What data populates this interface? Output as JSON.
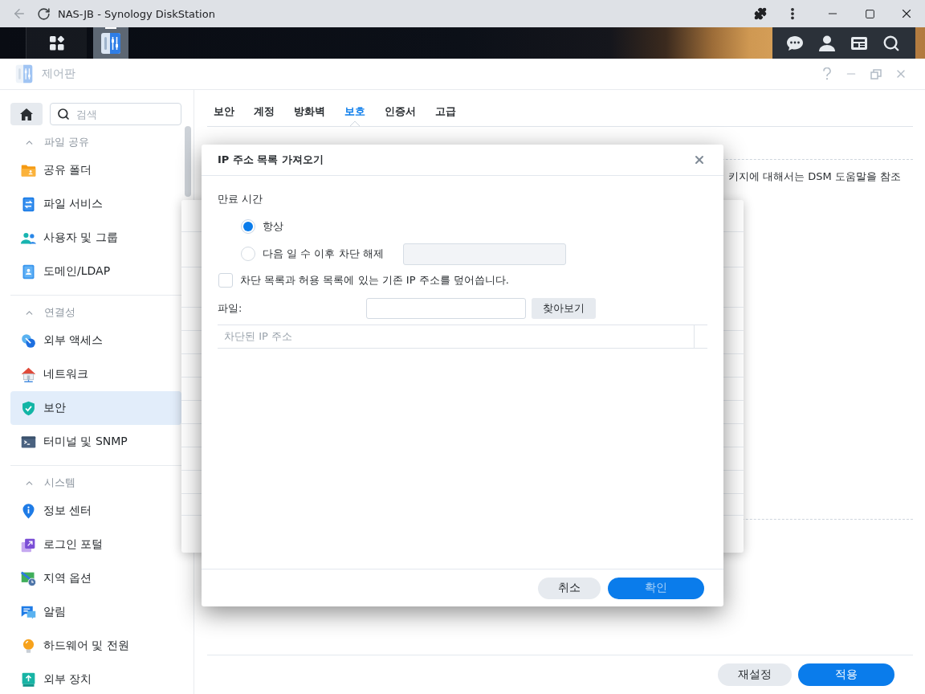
{
  "browser": {
    "title": "NAS-JB - Synology DiskStation"
  },
  "window": {
    "title": "제어판"
  },
  "sidebar": {
    "search": {
      "placeholder": "검색"
    },
    "sections": [
      {
        "title": "파일 공유",
        "expanded": true,
        "items": [
          {
            "label": "공유 폴더",
            "selected": false
          },
          {
            "label": "파일 서비스",
            "selected": false
          },
          {
            "label": "사용자 및 그룹",
            "selected": false
          },
          {
            "label": "도메인/LDAP",
            "selected": false
          }
        ]
      },
      {
        "title": "연결성",
        "expanded": true,
        "items": [
          {
            "label": "외부 액세스",
            "selected": false
          },
          {
            "label": "네트워크",
            "selected": false
          },
          {
            "label": "보안",
            "selected": true
          },
          {
            "label": "터미널 및 SNMP",
            "selected": false
          }
        ]
      },
      {
        "title": "시스템",
        "expanded": true,
        "items": [
          {
            "label": "정보 센터",
            "selected": false
          },
          {
            "label": "로그인 포털",
            "selected": false
          },
          {
            "label": "지역 옵션",
            "selected": false
          },
          {
            "label": "알림",
            "selected": false
          },
          {
            "label": "하드웨어 및 전원",
            "selected": false
          },
          {
            "label": "외부 장치",
            "selected": false
          }
        ]
      }
    ]
  },
  "tabs": [
    {
      "label": "보안",
      "selected": false
    },
    {
      "label": "계정",
      "selected": false
    },
    {
      "label": "방화벽",
      "selected": false
    },
    {
      "label": "보호",
      "selected": true
    },
    {
      "label": "인증서",
      "selected": false
    },
    {
      "label": "고급",
      "selected": false
    }
  ],
  "content": {
    "help_text": "키지에 대해서는 DSM 도움말을 참조"
  },
  "footer_buttons": [
    {
      "label": "재설정",
      "kind": "secondary"
    },
    {
      "label": "적용",
      "kind": "primary"
    }
  ],
  "dialog": {
    "title": "IP 주소 목록 가져오기",
    "expiry_label": "만료 시간",
    "expiry_options": [
      {
        "label": "항상",
        "selected": true
      },
      {
        "label": "다음 일 수 이후 차단 해제",
        "selected": false,
        "field": {
          "disabled": true
        }
      }
    ],
    "overwrite": {
      "label": "차단 목록과 허용 목록에 있는 기존 IP 주소를 덮어씁니다.",
      "checked": false
    },
    "file": {
      "label": "파일:",
      "button": "찾아보기"
    },
    "table": {
      "columns": [
        "차단된 IP 주소"
      ]
    },
    "buttons": [
      {
        "label": "취소",
        "kind": "secondary",
        "disabled": false
      },
      {
        "label": "확인",
        "kind": "primary",
        "disabled": true
      }
    ]
  }
}
